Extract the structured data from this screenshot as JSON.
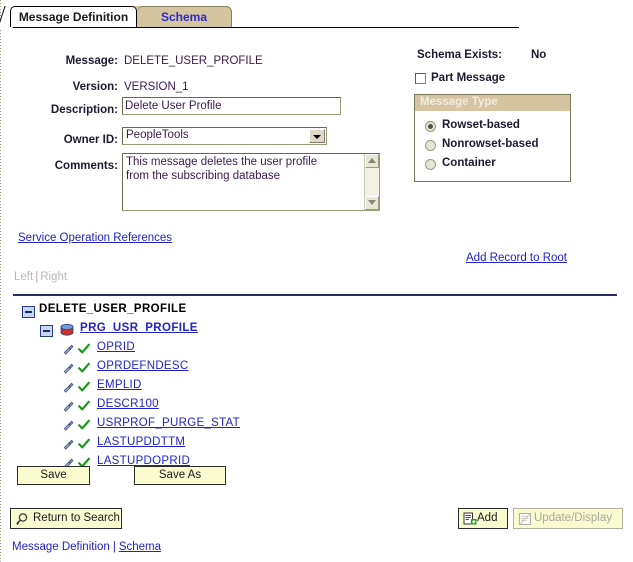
{
  "tabs": [
    {
      "label": "Message Definition",
      "active": true
    },
    {
      "label": "Schema",
      "active": false
    }
  ],
  "form": {
    "message": {
      "label": "Message:",
      "value": "DELETE_USER_PROFILE"
    },
    "version": {
      "label": "Version:",
      "value": "VERSION_1"
    },
    "description": {
      "label": "Description:",
      "value": "Delete User Profile",
      "placeholder": ""
    },
    "owner_id": {
      "label": "Owner ID:",
      "value": "PeopleTools",
      "options": [
        "PeopleTools"
      ]
    },
    "comments": {
      "label": "Comments:",
      "value": "This message deletes the user profile\nfrom the subscribing database",
      "placeholder": ""
    }
  },
  "right_panel": {
    "schema_exists_label": "Schema Exists:",
    "schema_exists_value": "No",
    "part_message": {
      "label": "Part Message",
      "checked": false
    },
    "message_type": {
      "title": "Message Type",
      "options": [
        {
          "label": "Rowset-based",
          "checked": true
        },
        {
          "label": "Nonrowset-based",
          "checked": false
        },
        {
          "label": "Container",
          "checked": false
        }
      ]
    }
  },
  "links": {
    "service_operation_references": "Service Operation References",
    "add_record_to_root": "Add Record to Root"
  },
  "panel_toggle": {
    "left": "Left",
    "separator": "|",
    "right": "Right"
  },
  "tree": {
    "root": {
      "label": "DELETE_USER_PROFILE",
      "expanded": true
    },
    "record": {
      "label": "PRG_USR_PROFILE",
      "expanded": true
    },
    "fields": [
      "OPRID",
      "OPRDEFNDESC",
      "EMPLID",
      "DESCR100",
      "USRPROF_PURGE_STAT",
      "LASTUPDDTTM",
      "LASTUPDOPRID"
    ]
  },
  "buttons": {
    "save": "Save",
    "save_as": "Save As",
    "return_to_search": "Return to Search",
    "add": "Add",
    "update_display": "Update/Display"
  },
  "footer": {
    "current": "Message Definition",
    "separator": "|",
    "link": "Schema"
  }
}
